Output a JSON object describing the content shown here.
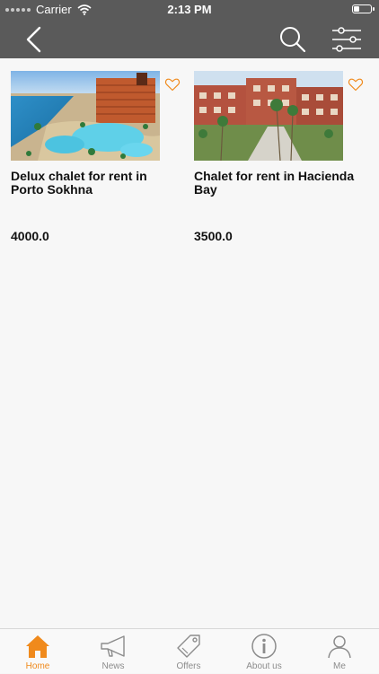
{
  "status_bar": {
    "carrier": "Carrier",
    "time": "2:13 PM"
  },
  "nav": {
    "back_icon": "chevron-left-icon",
    "search_icon": "search-icon",
    "filter_icon": "sliders-icon"
  },
  "listings": [
    {
      "title": "Delux chalet for rent in Porto Sokhna",
      "price": "4000.0"
    },
    {
      "title": "Chalet for rent in Hacienda Bay",
      "price": "3500.0"
    }
  ],
  "tabs": [
    {
      "label": "Home",
      "icon": "home-icon",
      "active": true
    },
    {
      "label": "News",
      "icon": "megaphone-icon",
      "active": false
    },
    {
      "label": "Offers",
      "icon": "tag-icon",
      "active": false
    },
    {
      "label": "About us",
      "icon": "info-icon",
      "active": false
    },
    {
      "label": "Me",
      "icon": "person-icon",
      "active": false
    }
  ],
  "colors": {
    "header_bg": "#5a5a5a",
    "accent": "#f08a1c",
    "page_bg": "#f7f7f7"
  }
}
